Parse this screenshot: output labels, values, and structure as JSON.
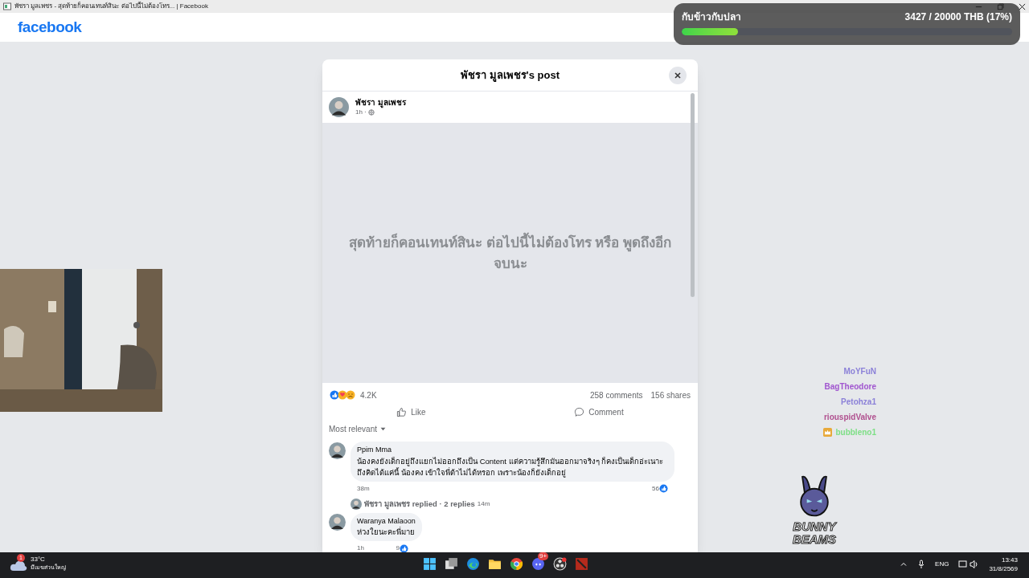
{
  "browser_tab": {
    "title": "พัชรา มูลเพชร - สุดท้ายก็คอนเทนท์สินะ ต่อไปนี้ไม่ต้องโทร... | Facebook"
  },
  "header": {
    "logo": "facebook"
  },
  "donation_overlay": {
    "title": "กับข้าวกับปลา",
    "progress_text": "3427 / 20000 THB (17%)",
    "level": 0.17
  },
  "post_dialog": {
    "title": "พัชรา มูลเพชร's post",
    "author": "พัชรา มูลเพชร",
    "time": "1h ·",
    "post_text": "สุดท้ายก็คอนเทนท์สินะ ต่อไปนี้ไม่ต้องโทร หรือ พูดถึงอีก จบนะ",
    "reaction_count": "4.2K",
    "comments_count": "258 comments",
    "shares_count": "156 shares",
    "actions": [
      {
        "kind": "like",
        "label": "Like"
      },
      {
        "kind": "comment",
        "label": "Comment"
      }
    ],
    "sort": "Most relevant",
    "comments": [
      {
        "author": "Ppim Mma",
        "text": "น้องคงยังเด็กอยู่ถึงแยกไม่ออกถึงเป็น Content แต่ความรู้สึกมันออกมาจริงๆ ก็คงเป็นเด็กอ่ะเนาะ ถึงคิดได้แค่นี้ น้องคง เข้าใจพี่ต้าไม่ได้หรอก เพราะน้องก็ยังเด็กอยู่",
        "time": "38m",
        "likes": "56",
        "reply_summary": {
          "author": "พัชรา มูลเพชร",
          "text": "replied · 2 replies",
          "time": "14m"
        }
      },
      {
        "author": "Waranya Malaoon",
        "text": "ห่วงใยนะคะพี่มาย",
        "time": "1h",
        "likes": "9"
      }
    ]
  },
  "chat": [
    {
      "name": "MoYFuN",
      "color": "#8b80d8",
      "badge": false
    },
    {
      "name": "BagTheodore",
      "color": "#a055cf",
      "badge": false
    },
    {
      "name": "Petohza1",
      "color": "#8b80d8",
      "badge": false
    },
    {
      "name": "riouspidValve",
      "color": "#b0508f",
      "badge": false
    },
    {
      "name": "bubbleno1",
      "color": "#7ddf85",
      "badge": true
    }
  ],
  "stream_logo": {
    "text": "BUNNY BEAMS"
  },
  "taskbar": {
    "weather_temp": "33°C",
    "weather_desc": "มีเมฆส่วนใหญ่",
    "weather_badge": "1",
    "discord_badge": "9+",
    "language": "ENG",
    "time": "13:43",
    "date": "31/8/2569"
  }
}
